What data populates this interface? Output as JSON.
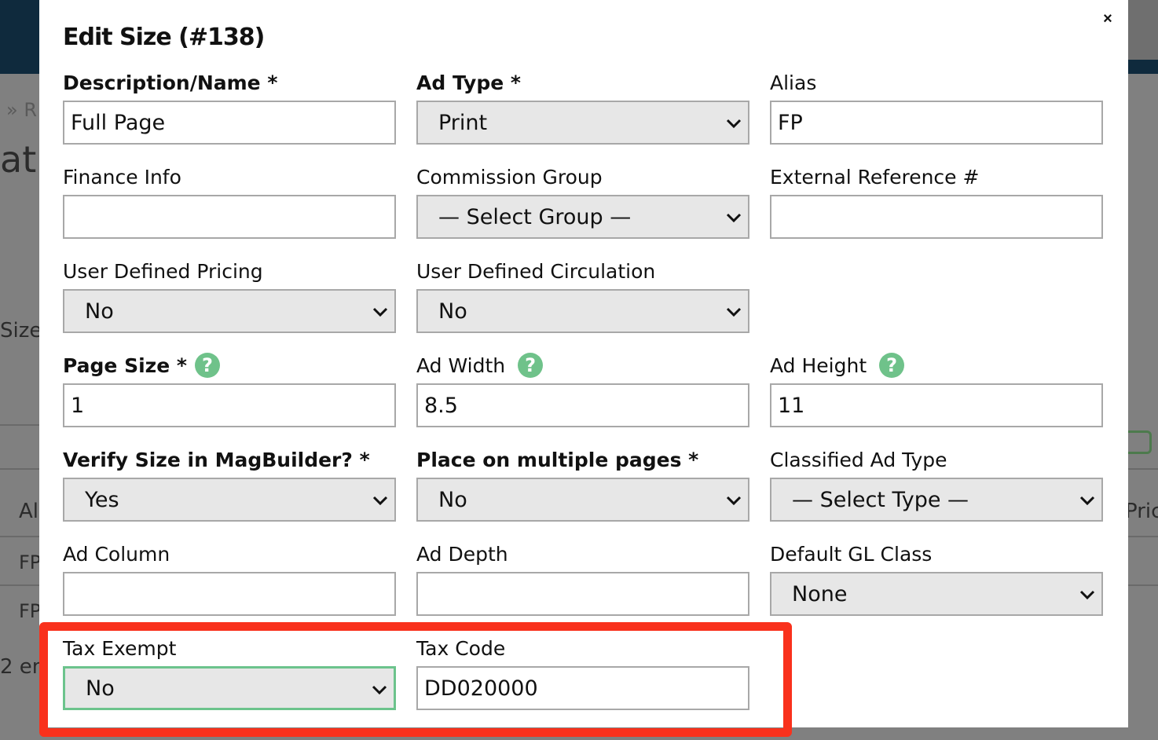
{
  "background": {
    "breadcrumb": "» R",
    "heading": "at",
    "label_size": "Size",
    "col_al": "Al",
    "row1": "FP",
    "row2": "FP",
    "entries": "2 en",
    "col_pric": "Pric"
  },
  "modal": {
    "title": "Edit Size (#138)",
    "close_label": "×"
  },
  "fields": {
    "description": {
      "label": "Description/Name *",
      "value": "Full Page"
    },
    "ad_type": {
      "label": "Ad Type *",
      "value": "Print"
    },
    "alias": {
      "label": "Alias",
      "value": "FP"
    },
    "finance_info": {
      "label": "Finance Info",
      "value": ""
    },
    "commission_group": {
      "label": "Commission Group",
      "value": "— Select Group —"
    },
    "external_ref": {
      "label": "External Reference #",
      "value": ""
    },
    "user_pricing": {
      "label": "User Defined Pricing",
      "value": "No"
    },
    "user_circulation": {
      "label": "User Defined Circulation",
      "value": "No"
    },
    "page_size": {
      "label": "Page Size *",
      "value": "1",
      "help": "?"
    },
    "ad_width": {
      "label": "Ad Width",
      "value": "8.5",
      "help": "?"
    },
    "ad_height": {
      "label": "Ad Height",
      "value": "11",
      "help": "?"
    },
    "verify_size": {
      "label": "Verify Size in MagBuilder? *",
      "value": "Yes"
    },
    "multiple_pages": {
      "label": "Place on multiple pages *",
      "value": "No"
    },
    "classified_type": {
      "label": "Classified Ad Type",
      "value": "— Select Type —"
    },
    "ad_column": {
      "label": "Ad Column",
      "value": ""
    },
    "ad_depth": {
      "label": "Ad Depth",
      "value": ""
    },
    "gl_class": {
      "label": "Default GL Class",
      "value": "None"
    },
    "tax_exempt": {
      "label": "Tax Exempt",
      "value": "No"
    },
    "tax_code": {
      "label": "Tax Code",
      "value": "DD020000"
    }
  },
  "colors": {
    "highlight": "#f9311c",
    "help_icon": "#6fc28a",
    "focus_border": "#6cc38c",
    "topbar": "#0f2a3d"
  }
}
